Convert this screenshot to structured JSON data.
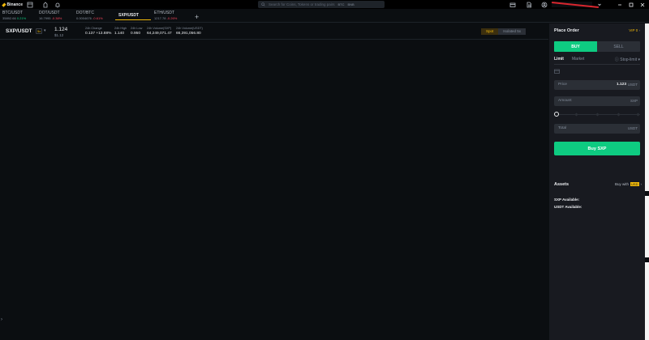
{
  "app": {
    "name": "Binance"
  },
  "search": {
    "placeholder": "Search for Coins, Tokens or trading pairs",
    "chips": [
      "BTC",
      "BNB"
    ]
  },
  "window_controls": [
    "minimize",
    "maximize",
    "close"
  ],
  "tabs": [
    {
      "pair": "BTC/USDT",
      "price": "35892.66",
      "change": "0.21%",
      "trend": "up"
    },
    {
      "pair": "DOT/USDT",
      "price": "16.7995",
      "change": "-0.38%",
      "trend": "down"
    },
    {
      "pair": "DOT/BTC",
      "price": "0.0004676",
      "change": "-0.61%",
      "trend": "down"
    },
    {
      "pair": "SXP/USDT",
      "price": "",
      "change": "",
      "trend": ""
    },
    {
      "pair": "ETH/USDT",
      "price": "1217.78",
      "change": "-0.26%",
      "trend": "down"
    }
  ],
  "active_tab": "SXP/USDT",
  "ticker": {
    "symbol": "SXP/USDT",
    "leverage": "5x",
    "last_price": "1.124",
    "sub_price": "$1.12",
    "stats": [
      {
        "key": "24h Change",
        "value": "0.137 +13.88%"
      },
      {
        "key": "24h High",
        "value": "1.140"
      },
      {
        "key": "24h Low",
        "value": "0.950"
      },
      {
        "key": "24h Volume(SXP)",
        "value": "64,249,071.47"
      },
      {
        "key": "24h Volume(USDT)",
        "value": "66,391,056.80"
      }
    ],
    "modes": [
      "Spot",
      "Isolated 5x"
    ],
    "active_mode": "Spot"
  },
  "order": {
    "title": "Place Order",
    "vip": "VIP 0",
    "buy_label": "BUY",
    "sell_label": "SELL",
    "types": [
      "Limit",
      "Market",
      "Stop-limit"
    ],
    "price_label": "Price",
    "price_value": "1.123",
    "price_unit": "USDT",
    "amount_label": "Amount",
    "amount_unit": "SXP",
    "slider_percent": 0,
    "total_label": "Total",
    "total_unit": "USDT",
    "submit_label": "Buy SXP"
  },
  "assets": {
    "title": "Assets",
    "buy_with": "Buy with",
    "currency": "USD",
    "rows": [
      "SXP Available:",
      "USDT Available:"
    ]
  },
  "colors": {
    "accent": "#f0b90b",
    "buy": "#0ecb81",
    "sell": "#f6465d",
    "background": "#0b0e11",
    "panel": "#181a20"
  }
}
